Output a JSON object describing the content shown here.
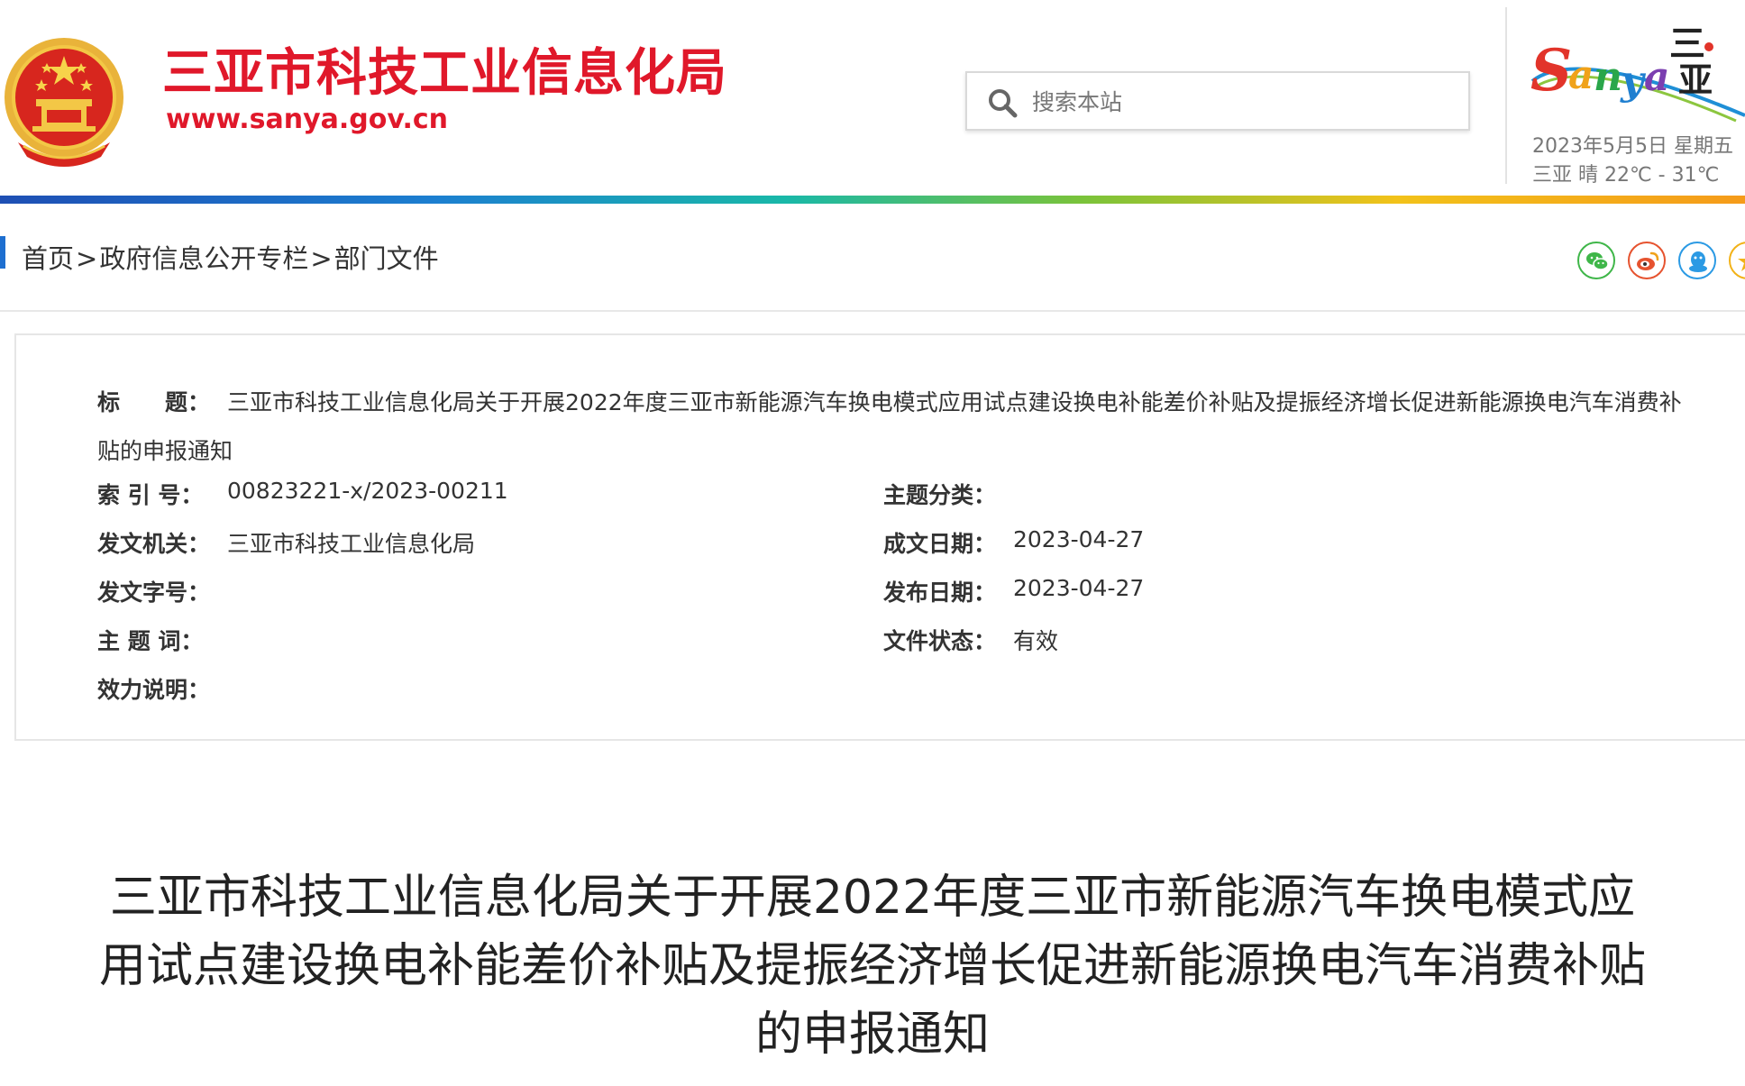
{
  "header": {
    "site_title": "三亚市科技工业信息化局",
    "site_url": "www.sanya.gov.cn",
    "search_placeholder": "搜索本站",
    "logo_text": "Sanya三亚",
    "date": "2023年5月5日 星期五",
    "weather": "三亚  晴  22℃ - 31℃"
  },
  "breadcrumb": {
    "items": [
      "首页",
      "政府信息公开专栏",
      "部门文件"
    ],
    "separator": ">"
  },
  "share": {
    "icons": [
      "wechat-icon",
      "weibo-icon",
      "qq-icon",
      "qzone-icon"
    ]
  },
  "info": {
    "title_label": "标　　题：",
    "title_value": "三亚市科技工业信息化局关于开展2022年度三亚市新能源汽车换电模式应用试点建设换电补能差价补贴及提振经济增长促进新能源换电汽车消费补贴的申报通知",
    "index_label": "索 引 号：",
    "index_value": "00823221-x/2023-00211",
    "topic_category_label": "主题分类：",
    "topic_category_value": "",
    "issuer_label": "发文机关：",
    "issuer_value": "三亚市科技工业信息化局",
    "creation_date_label": "成文日期：",
    "creation_date_value": "2023-04-27",
    "doc_number_label": "发文字号：",
    "doc_number_value": "",
    "publish_date_label": "发布日期：",
    "publish_date_value": "2023-04-27",
    "keywords_label": "主 题 词：",
    "keywords_value": "",
    "status_label": "文件状态：",
    "status_value": "有效",
    "validity_label": "效力说明：",
    "validity_value": ""
  },
  "article": {
    "title": "三亚市科技工业信息化局关于开展2022年度三亚市新能源汽车换电模式应用试点建设换电补能差价补贴及提振经济增长促进新能源换电汽车消费补贴的申报通知"
  },
  "colors": {
    "brand_red": "#e0182a",
    "breadcrumb_accent": "#1e6fd0",
    "wechat": "#3fb649",
    "weibo": "#e6532f",
    "qq": "#2b9ae4",
    "qzone": "#f2b218"
  }
}
